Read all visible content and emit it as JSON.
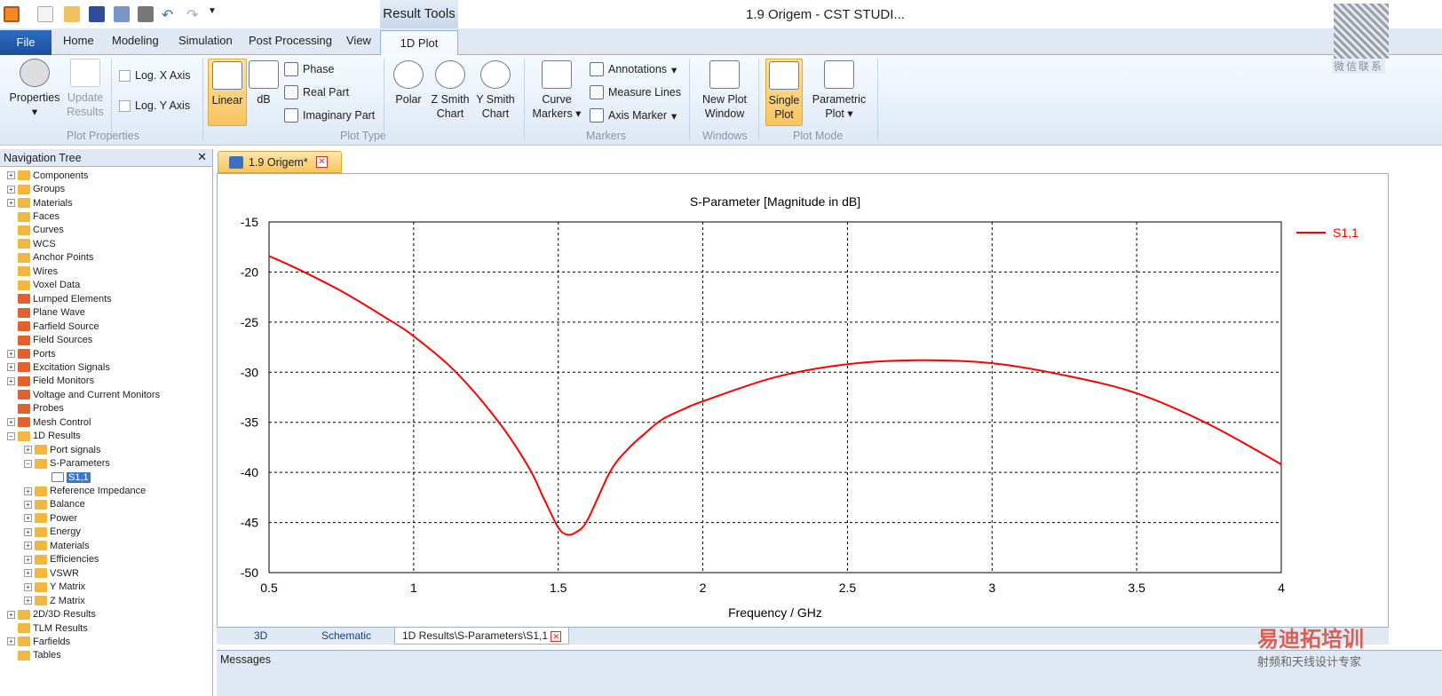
{
  "app": {
    "title": "1.9 Origem - CST STUDI...",
    "context_tab": "Result Tools"
  },
  "ribbon_tabs": [
    "File",
    "Home",
    "Modeling",
    "Simulation",
    "Post Processing",
    "View",
    "1D Plot"
  ],
  "ribbon": {
    "properties": "Properties",
    "update": "Update",
    "results": "Results",
    "log_x": "Log. X Axis",
    "log_y": "Log. Y Axis",
    "group_plot_properties": "Plot Properties",
    "linear": "Linear",
    "db": "dB",
    "phase": "Phase",
    "real": "Real Part",
    "imag": "Imaginary Part",
    "group_plot_type": "Plot Type",
    "polar": "Polar",
    "zsmith1": "Z Smith",
    "zsmith2": "Chart",
    "ysmith1": "Y Smith",
    "ysmith2": "Chart",
    "curve_markers1": "Curve",
    "curve_markers2": "Markers",
    "annotations": "Annotations",
    "measure_lines": "Measure Lines",
    "axis_marker": "Axis Marker",
    "group_markers": "Markers",
    "new_plot1": "New Plot",
    "new_plot2": "Window",
    "group_windows": "Windows",
    "single1": "Single",
    "single2": "Plot",
    "param1": "Parametric",
    "param2": "Plot",
    "group_plot_mode": "Plot Mode"
  },
  "watermark": {
    "qr_caption": "微信联系",
    "brand": "易迪拓培训",
    "brand_sub": "射频和天线设计专家"
  },
  "nav": {
    "title": "Navigation Tree",
    "items": [
      {
        "label": "Components",
        "lvl": 0,
        "exp": "+",
        "c": "y"
      },
      {
        "label": "Groups",
        "lvl": 0,
        "exp": "+",
        "c": "y"
      },
      {
        "label": "Materials",
        "lvl": 0,
        "exp": "+",
        "c": "y"
      },
      {
        "label": "Faces",
        "lvl": 0,
        "exp": "",
        "c": "y"
      },
      {
        "label": "Curves",
        "lvl": 0,
        "exp": "",
        "c": "y"
      },
      {
        "label": "WCS",
        "lvl": 0,
        "exp": "",
        "c": "y"
      },
      {
        "label": "Anchor Points",
        "lvl": 0,
        "exp": "",
        "c": "y"
      },
      {
        "label": "Wires",
        "lvl": 0,
        "exp": "",
        "c": "y"
      },
      {
        "label": "Voxel Data",
        "lvl": 0,
        "exp": "",
        "c": "y"
      },
      {
        "label": "Lumped Elements",
        "lvl": 0,
        "exp": "",
        "c": "r"
      },
      {
        "label": "Plane Wave",
        "lvl": 0,
        "exp": "",
        "c": "r"
      },
      {
        "label": "Farfield Source",
        "lvl": 0,
        "exp": "",
        "c": "r"
      },
      {
        "label": "Field Sources",
        "lvl": 0,
        "exp": "",
        "c": "r"
      },
      {
        "label": "Ports",
        "lvl": 0,
        "exp": "+",
        "c": "r"
      },
      {
        "label": "Excitation Signals",
        "lvl": 0,
        "exp": "+",
        "c": "r"
      },
      {
        "label": "Field Monitors",
        "lvl": 0,
        "exp": "+",
        "c": "r"
      },
      {
        "label": "Voltage and Current Monitors",
        "lvl": 0,
        "exp": "",
        "c": "r"
      },
      {
        "label": "Probes",
        "lvl": 0,
        "exp": "",
        "c": "r"
      },
      {
        "label": "Mesh Control",
        "lvl": 0,
        "exp": "+",
        "c": "r"
      },
      {
        "label": "1D Results",
        "lvl": 0,
        "exp": "-",
        "c": "y"
      },
      {
        "label": "Port signals",
        "lvl": 1,
        "exp": "+",
        "c": "y"
      },
      {
        "label": "S-Parameters",
        "lvl": 1,
        "exp": "-",
        "c": "y"
      },
      {
        "label": "S1,1",
        "lvl": 2,
        "exp": "",
        "c": "s"
      },
      {
        "label": "Reference Impedance",
        "lvl": 1,
        "exp": "+",
        "c": "y"
      },
      {
        "label": "Balance",
        "lvl": 1,
        "exp": "+",
        "c": "y"
      },
      {
        "label": "Power",
        "lvl": 1,
        "exp": "+",
        "c": "y"
      },
      {
        "label": "Energy",
        "lvl": 1,
        "exp": "+",
        "c": "y"
      },
      {
        "label": "Materials",
        "lvl": 1,
        "exp": "+",
        "c": "y"
      },
      {
        "label": "Efficiencies",
        "lvl": 1,
        "exp": "+",
        "c": "y"
      },
      {
        "label": "VSWR",
        "lvl": 1,
        "exp": "+",
        "c": "y"
      },
      {
        "label": "Y Matrix",
        "lvl": 1,
        "exp": "+",
        "c": "y"
      },
      {
        "label": "Z Matrix",
        "lvl": 1,
        "exp": "+",
        "c": "y"
      },
      {
        "label": "2D/3D Results",
        "lvl": 0,
        "exp": "+",
        "c": "y"
      },
      {
        "label": "TLM Results",
        "lvl": 0,
        "exp": "",
        "c": "y"
      },
      {
        "label": "Farfields",
        "lvl": 0,
        "exp": "+",
        "c": "y"
      },
      {
        "label": "Tables",
        "lvl": 0,
        "exp": "",
        "c": "y"
      }
    ]
  },
  "doc_tab": "1.9 Origem*",
  "bottom_tabs": [
    "3D",
    "Schematic",
    "1D Results\\S-Parameters\\S1,1"
  ],
  "messages": "Messages",
  "chart_data": {
    "type": "line",
    "title": "S-Parameter [Magnitude in dB]",
    "xlabel": "Frequency / GHz",
    "ylabel": "",
    "xlim": [
      0.5,
      4
    ],
    "ylim": [
      -50,
      -15
    ],
    "grid": true,
    "legend": "top-right",
    "xticks": [
      "0.5",
      "1",
      "1.5",
      "2",
      "2.5",
      "3",
      "3.5",
      "4"
    ],
    "yticks": [
      "-15",
      "-20",
      "-25",
      "-30",
      "-35",
      "-40",
      "-45",
      "-50"
    ],
    "series": [
      {
        "name": "S1,1",
        "color": "#ff0000",
        "x": [
          0.5,
          0.6,
          0.75,
          0.9,
          1.0,
          1.15,
          1.3,
          1.4,
          1.45,
          1.5,
          1.53,
          1.56,
          1.6,
          1.68,
          1.74,
          1.8,
          1.86,
          1.94,
          2.0,
          2.25,
          2.5,
          2.75,
          3.0,
          3.25,
          3.5,
          3.75,
          4.0
        ],
        "y": [
          -18.4,
          -19.7,
          -21.9,
          -24.5,
          -26.4,
          -30.1,
          -35.2,
          -39.6,
          -42.6,
          -45.5,
          -46.2,
          -46.0,
          -44.8,
          -39.9,
          -37.7,
          -36.1,
          -34.7,
          -33.6,
          -32.9,
          -30.5,
          -29.2,
          -28.8,
          -29.1,
          -30.3,
          -32.1,
          -35.2,
          -39.2
        ]
      }
    ]
  }
}
